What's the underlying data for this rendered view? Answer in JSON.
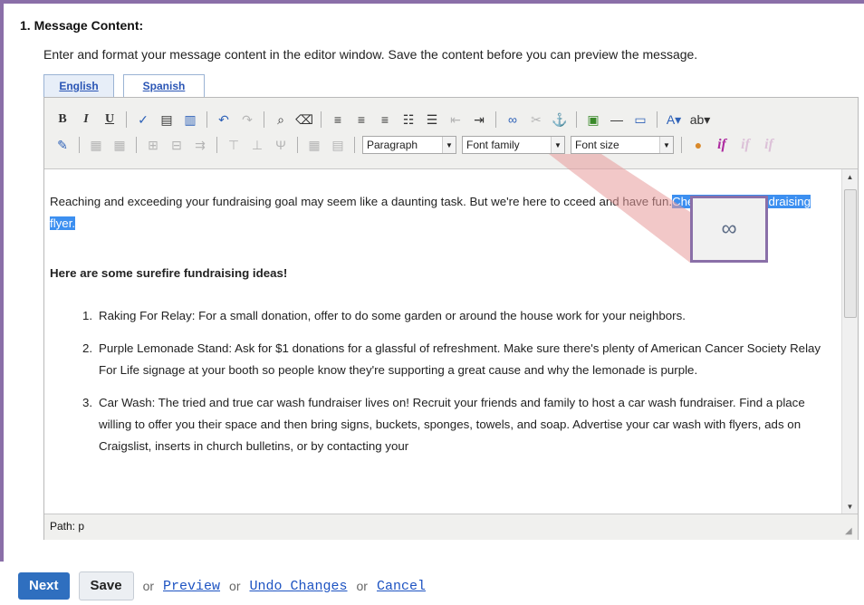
{
  "section": {
    "number": "1.",
    "title": "Message Content:",
    "instructions": "Enter and format your message content in the editor window. Save the content before you can preview the message."
  },
  "tabs": [
    {
      "label": "English"
    },
    {
      "label": "Spanish"
    }
  ],
  "toolbar": {
    "row1": {
      "bold": "B",
      "italic": "I",
      "underline": "U"
    },
    "selects": {
      "format": "Paragraph",
      "font_family": "Font family",
      "font_size": "Font size"
    },
    "if_label": "if",
    "icons_row1": [
      "spellcheck-icon",
      "paste-text-icon",
      "paste-word-icon",
      "undo-icon",
      "redo-icon",
      "find-icon",
      "eraser-icon",
      "align-left-icon",
      "align-center-icon",
      "align-right-icon",
      "numbered-list-icon",
      "bullet-list-icon",
      "outdent-icon",
      "indent-icon",
      "link-icon",
      "unlink-icon",
      "anchor-icon",
      "image-icon",
      "horizontal-rule-icon",
      "html-icon",
      "font-color-icon",
      "highlight-icon"
    ],
    "icons_row2": [
      "edit-icon",
      "table-icon",
      "table-props-icon",
      "insert-column-icon",
      "delete-column-icon",
      "split-cells-icon",
      "row-icon",
      "merge-cells-icon",
      "cell-props-icon",
      "table-delete-icon",
      "personalize-icon"
    ]
  },
  "content": {
    "p1_before": "Reaching and exceeding your fundraising goal may seem like a daunting task. But we're here to ",
    "p1_after": "cceed and have fun.",
    "p1_selected": "Check out this fundraising flyer.",
    "heading": "Here are some surefire fundraising ideas!",
    "list": [
      {
        "num": "1.",
        "text": "Raking For Relay: For a small donation, offer to do some garden or around the house work for your neighbors."
      },
      {
        "num": "2.",
        "text": "Purple Lemonade Stand: Ask for $1 donations for a glassful of refreshment. Make sure there's plenty of American Cancer Society Relay For Life signage at your booth so people know they're supporting a great cause and why the lemonade is purple."
      },
      {
        "num": "3.",
        "text": "Car Wash: The tried and true car wash fundraiser lives on! Recruit your friends and family to host a car wash fundraiser. Find a place willing to offer you their space and then bring signs, buckets, sponges, towels, and soap. Advertise your car wash with flyers, ads on Craigslist, inserts in church bulletins, or by contacting your"
      }
    ]
  },
  "statusbar": {
    "path": "Path: p"
  },
  "actions": {
    "next": "Next",
    "save": "Save",
    "or": "or",
    "preview": "Preview",
    "undo": "Undo Changes",
    "cancel": "Cancel"
  },
  "colors": {
    "frame": "#8a6fa8",
    "highlight": "#3c8ff0",
    "next_button": "#2f6fbf",
    "link": "#1d53c2"
  }
}
